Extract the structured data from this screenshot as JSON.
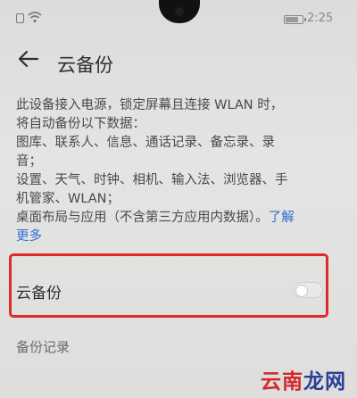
{
  "status_bar": {
    "time": "2:25",
    "battery_level": 0.7
  },
  "header": {
    "title": "云备份"
  },
  "description": {
    "lines": [
      "此设备接入电源，锁定屏幕且连接 WLAN 时，",
      "将自动备份以下数据：",
      "图库、联系人、信息、通话记录、备忘录、录",
      "音；",
      "设置、天气、时钟、相机、输入法、浏览器、手",
      "机管家、WLAN；"
    ],
    "last_line": "桌面布局与应用（不含第三方应用内数据）。",
    "learn_more_part1": "了解",
    "learn_more_part2": "更多"
  },
  "cloud_backup_toggle": {
    "label": "云备份",
    "state": "off"
  },
  "backup_records": {
    "label": "备份记录"
  },
  "watermark": {
    "part1": "云南",
    "part2": "龙网"
  },
  "colors": {
    "highlight": "#e02a2a",
    "link": "#2d6fd0"
  }
}
